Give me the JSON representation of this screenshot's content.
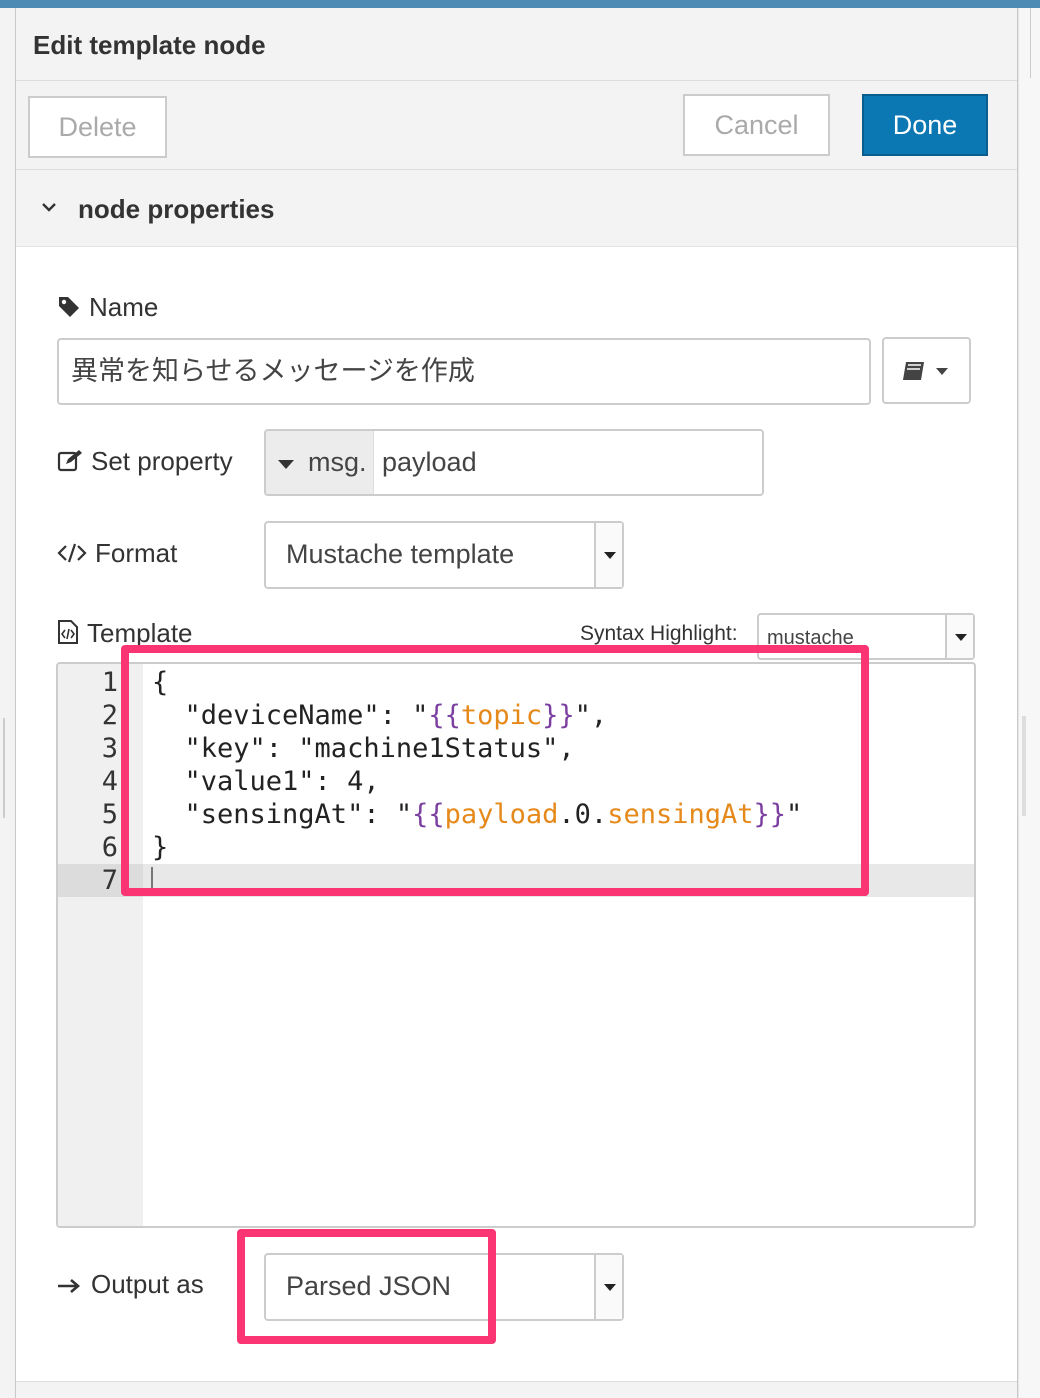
{
  "header": {
    "title": "Edit template node"
  },
  "buttons": {
    "delete": "Delete",
    "cancel": "Cancel",
    "done": "Done"
  },
  "section": {
    "label": "node properties"
  },
  "fields": {
    "name": {
      "label": "Name",
      "value": "異常を知らせるメッセージを作成"
    },
    "set_property": {
      "label": "Set property",
      "type": "msg.",
      "value": "payload"
    },
    "format": {
      "label": "Format",
      "value": "Mustache template"
    },
    "template": {
      "label": "Template",
      "syntax_label": "Syntax Highlight:",
      "syntax_value": "mustache"
    },
    "output": {
      "label": "Output as",
      "value": "Parsed JSON"
    }
  },
  "editor": {
    "line_numbers": [
      "1",
      "2",
      "3",
      "4",
      "5",
      "6",
      "7"
    ],
    "lines": [
      "{",
      "  \"deviceName\": \"{{topic}}\",",
      "  \"key\": \"machine1Status\",",
      "  \"value1\": 4,",
      "  \"sensingAt\": \"{{payload.0.sensingAt}}\"",
      "}",
      ""
    ],
    "active_line": 7
  },
  "icons": {
    "name": "tag-icon",
    "set_property": "edit-icon",
    "format": "code-icon",
    "template": "file-code-icon",
    "output": "arrow-right-icon",
    "library": "book-icon",
    "section": "chevron-down-icon"
  },
  "colors": {
    "accent": "#0b77b3",
    "highlight_box": "#fb3474",
    "mustache_brace": "#7a3fa0",
    "mustache_var": "#e6891b"
  }
}
